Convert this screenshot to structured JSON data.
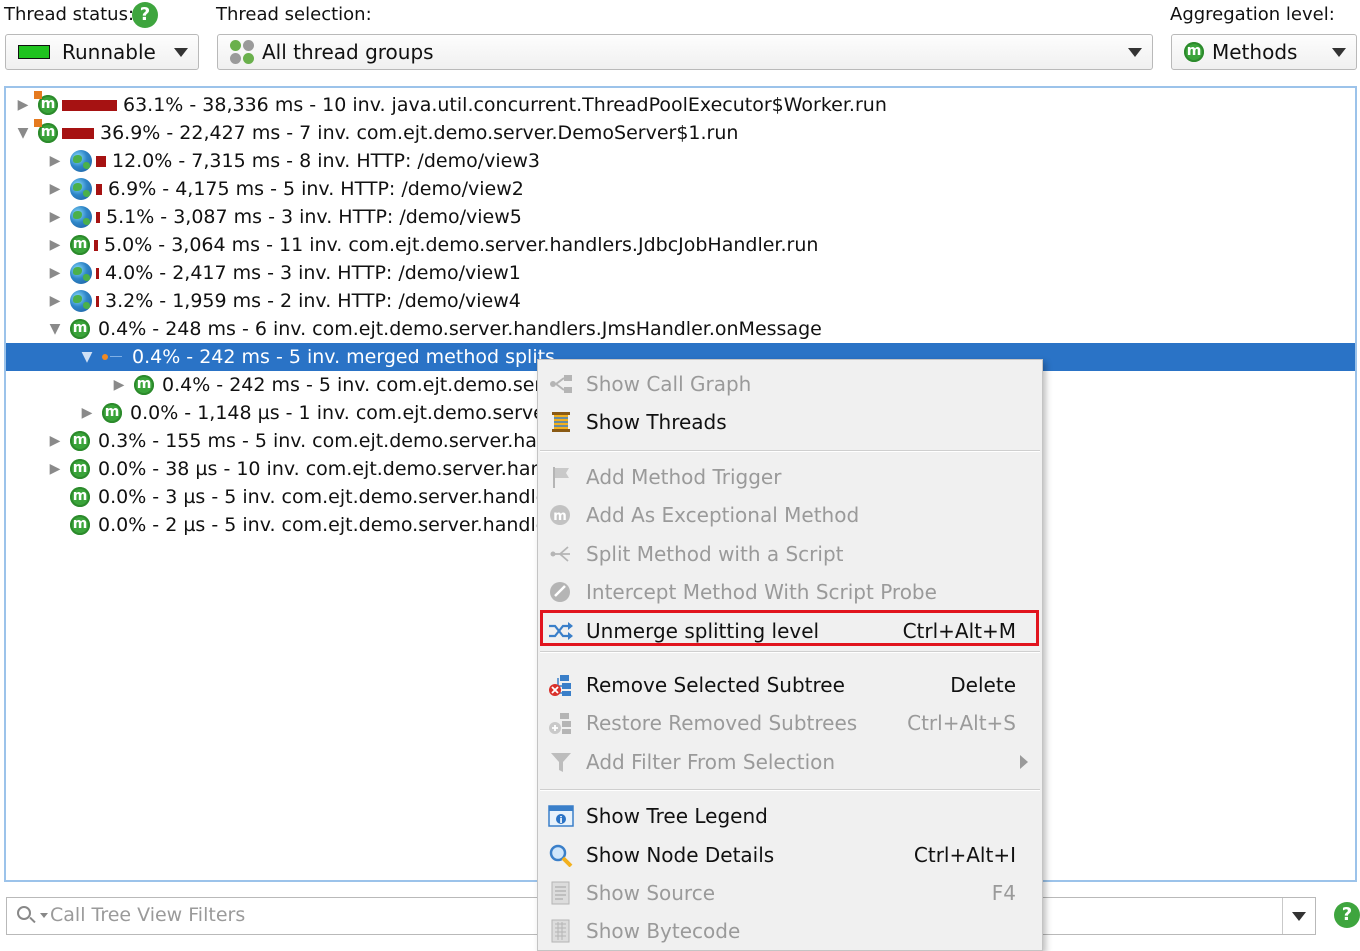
{
  "toolbar": {
    "thread_status_label": "Thread status:",
    "thread_status_value": "Runnable",
    "thread_selection_label": "Thread selection:",
    "thread_selection_value": "All thread groups",
    "aggregation_label": "Aggregation level:",
    "aggregation_value": "Methods",
    "help_glyph": "?"
  },
  "colors": {
    "selection": "#2a73c6",
    "bar": "#a61212",
    "method_icon": "#3aa43a",
    "highlight_border": "#e1141e",
    "runnable": "#1fc31f"
  },
  "tree": {
    "method_glyph": "m",
    "rows": [
      {
        "text": "63.1% - 38,336 ms - 10 inv. java.util.concurrent.ThreadPoolExecutor$Worker.run",
        "icon": "method-icon",
        "expand": "collapsed",
        "bar_fraction": 1.0
      },
      {
        "text": "36.9% - 22,427 ms - 7 inv. com.ejt.demo.server.DemoServer$1.run",
        "icon": "method-icon",
        "expand": "expanded",
        "bar_fraction": 0.585
      },
      {
        "text": "12.0% - 7,315 ms - 8 inv. HTTP: /demo/view3",
        "icon": "globe-icon",
        "expand": "collapsed",
        "bar_fraction": 0.19
      },
      {
        "text": "6.9% - 4,175 ms - 5 inv. HTTP: /demo/view2",
        "icon": "globe-icon",
        "expand": "collapsed",
        "bar_fraction": 0.11
      },
      {
        "text": "5.1% - 3,087 ms - 3 inv. HTTP: /demo/view5",
        "icon": "globe-icon",
        "expand": "collapsed",
        "bar_fraction": 0.08
      },
      {
        "text": "5.0% - 3,064 ms - 11 inv. com.ejt.demo.server.handlers.JdbcJobHandler.run",
        "icon": "method-icon",
        "expand": "collapsed",
        "bar_fraction": 0.08
      },
      {
        "text": "4.0% - 2,417 ms - 3 inv. HTTP: /demo/view1",
        "icon": "globe-icon",
        "expand": "collapsed",
        "bar_fraction": 0.063
      },
      {
        "text": "3.2% - 1,959 ms - 2 inv. HTTP: /demo/view4",
        "icon": "globe-icon",
        "expand": "collapsed",
        "bar_fraction": 0.05
      },
      {
        "text": "0.4% - 248 ms - 6 inv. com.ejt.demo.server.handlers.JmsHandler.onMessage",
        "icon": "method-icon",
        "expand": "expanded",
        "bar_fraction": 0
      },
      {
        "text": "0.4% - 242 ms - 5 inv. merged method splits",
        "icon": "split-icon",
        "expand": "expanded",
        "bar_fraction": 0,
        "selected": true
      },
      {
        "text": "0.4% - 242 ms - 5 inv. com.ejt.demo.ser",
        "icon": "method-icon",
        "expand": "collapsed",
        "bar_fraction": 0
      },
      {
        "text": "0.0% - 1,148 µs - 1 inv. com.ejt.demo.serve",
        "icon": "method-icon",
        "expand": "collapsed",
        "bar_fraction": 0
      },
      {
        "text": "0.3% - 155 ms - 5 inv. com.ejt.demo.server.har",
        "icon": "method-icon",
        "expand": "collapsed",
        "bar_fraction": 0
      },
      {
        "text": "0.0% - 38 µs - 10 inv. com.ejt.demo.server.han",
        "icon": "method-icon",
        "expand": "collapsed",
        "bar_fraction": 0
      },
      {
        "text": "0.0% - 3 µs - 5 inv. com.ejt.demo.server.handle",
        "icon": "method-icon",
        "expand": "none",
        "bar_fraction": 0
      },
      {
        "text": "0.0% - 2 µs - 5 inv. com.ejt.demo.server.handle",
        "icon": "method-icon",
        "expand": "none",
        "bar_fraction": 0
      }
    ]
  },
  "context_menu": {
    "items": [
      {
        "label": "Show Call Graph",
        "shortcut": "",
        "enabled": false,
        "icon": "call-graph-icon"
      },
      {
        "label": "Show Threads",
        "shortcut": "",
        "enabled": true,
        "icon": "threads-icon"
      },
      {
        "label": "Add Method Trigger",
        "shortcut": "",
        "enabled": false,
        "icon": "flag-icon"
      },
      {
        "label": "Add As Exceptional Method",
        "shortcut": "",
        "enabled": false,
        "icon": "exceptional-method-icon"
      },
      {
        "label": "Split Method with a Script",
        "shortcut": "",
        "enabled": false,
        "icon": "split-script-icon"
      },
      {
        "label": "Intercept Method With Script Probe",
        "shortcut": "",
        "enabled": false,
        "icon": "probe-icon"
      },
      {
        "label": "Unmerge splitting level",
        "shortcut": "Ctrl+Alt+M",
        "enabled": true,
        "icon": "unmerge-icon",
        "highlighted": true
      },
      {
        "label": "Remove Selected Subtree",
        "shortcut": "Delete",
        "enabled": true,
        "icon": "remove-subtree-icon"
      },
      {
        "label": "Restore Removed Subtrees",
        "shortcut": "Ctrl+Alt+S",
        "enabled": false,
        "icon": "restore-subtree-icon"
      },
      {
        "label": "Add Filter From Selection",
        "shortcut": "",
        "enabled": false,
        "icon": "filter-icon",
        "submenu": true
      },
      {
        "label": "Show Tree Legend",
        "shortcut": "",
        "enabled": true,
        "icon": "legend-icon"
      },
      {
        "label": "Show Node Details",
        "shortcut": "Ctrl+Alt+I",
        "enabled": true,
        "icon": "node-details-icon"
      },
      {
        "label": "Show Source",
        "shortcut": "F4",
        "enabled": false,
        "icon": "source-icon"
      },
      {
        "label": "Show Bytecode",
        "shortcut": "",
        "enabled": false,
        "icon": "bytecode-icon"
      }
    ]
  },
  "filter": {
    "placeholder": "Call Tree View Filters"
  }
}
